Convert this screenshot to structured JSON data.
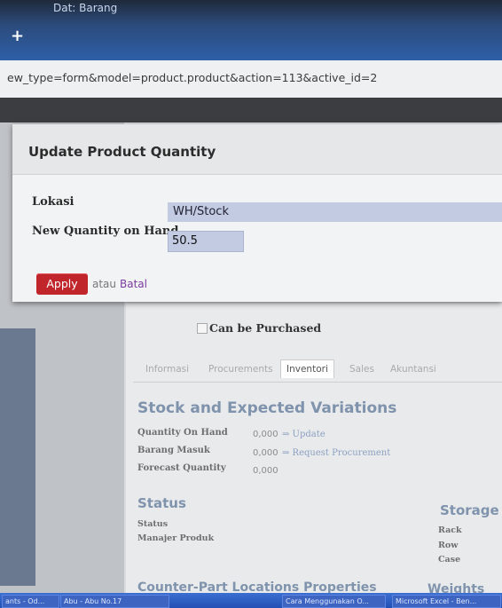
{
  "browser": {
    "tab_text": "Dat: Barang",
    "new_tab": "+",
    "url": "ew_type=form&model=product.product&action=113&active_id=2"
  },
  "modal": {
    "title": "Update Product Quantity",
    "location_label": "Lokasi",
    "location_value": "WH/Stock",
    "qty_label": "New Quantity on Hand",
    "qty_value": "50.5",
    "apply": "Apply",
    "or": "atau",
    "cancel": "Batal"
  },
  "form": {
    "can_be_purchased": "Can be Purchased",
    "tabs": [
      "Informasi",
      "Procurements",
      "Inventori",
      "Sales",
      "Akuntansi"
    ],
    "active_tab": 2,
    "stock_title": "Stock and Expected Variations",
    "qty_on_hand_label": "Quantity On Hand",
    "qty_on_hand_value": "0,000",
    "update_link": "⇒ Update",
    "incoming_label": "Barang Masuk",
    "incoming_value": "0,000",
    "procurement_link": "⇒ Request Procurement",
    "forecast_label": "Forecast Quantity",
    "forecast_value": "0,000",
    "status_title": "Status",
    "status_label": "Status",
    "manager_label": "Manajer Produk",
    "storage_title": "Storage L",
    "rack_label": "Rack",
    "row_label": "Row",
    "case_label": "Case",
    "counterpart_title": "Counter-Part Locations Properties",
    "weights_title": "Weights"
  },
  "taskbar": [
    "ants - Od...",
    "Abu - Abu No.17",
    "Cara Menggunakan O...",
    "Microsoft Excel - Ben..."
  ]
}
